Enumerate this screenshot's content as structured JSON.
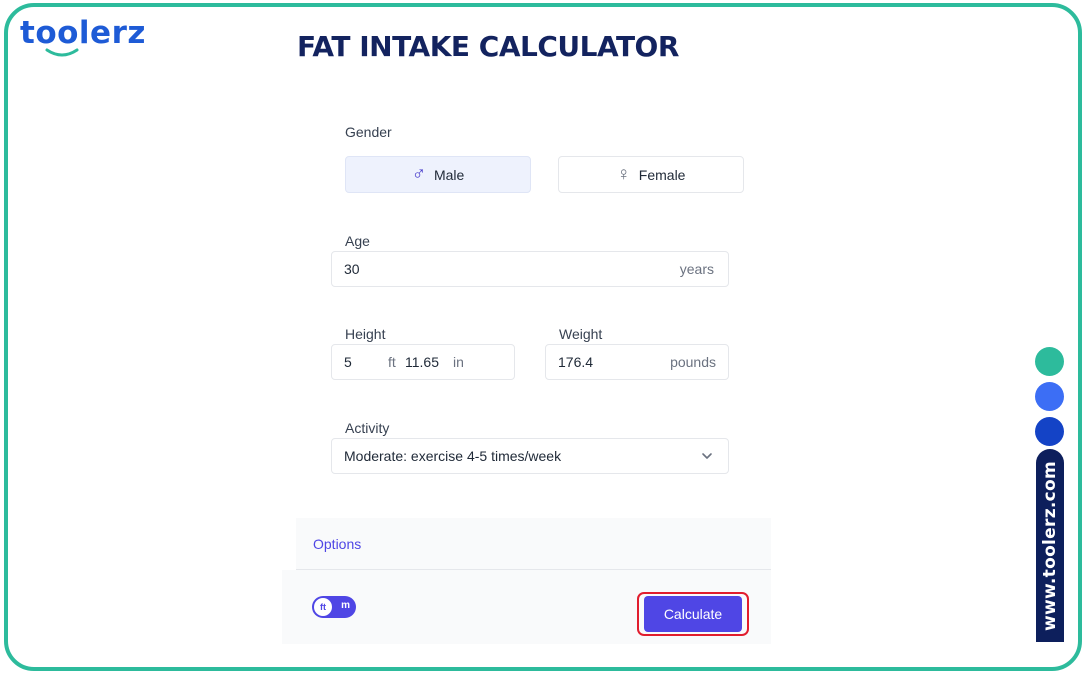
{
  "brand": {
    "logo_text": "toolerz",
    "watermark": "www.toolerz.com"
  },
  "page": {
    "title": "FAT INTAKE CALCULATOR"
  },
  "form": {
    "gender": {
      "label": "Gender",
      "options": [
        {
          "label": "Male",
          "symbol": "♂",
          "selected": true
        },
        {
          "label": "Female",
          "symbol": "♀",
          "selected": false
        }
      ]
    },
    "age": {
      "label": "Age",
      "value": "30",
      "unit": "years"
    },
    "height": {
      "label": "Height",
      "feet": "5",
      "feet_unit": "ft",
      "inches": "11.65",
      "inches_unit": "in"
    },
    "weight": {
      "label": "Weight",
      "value": "176.4",
      "unit": "pounds"
    },
    "activity": {
      "label": "Activity",
      "selected": "Moderate: exercise 4-5 times/week"
    }
  },
  "options": {
    "label": "Options"
  },
  "unit_toggle": {
    "left": "ft",
    "right": "m"
  },
  "actions": {
    "calculate": "Calculate"
  },
  "colors": {
    "frame": "#2dbb9c",
    "brand": "#1e5bd6",
    "accent": "#4f46e5",
    "highlight": "#e11d2e",
    "title": "#13235f",
    "dot_1": "#2dbb9c",
    "dot_2": "#3c6ef5",
    "dot_3": "#1443c6",
    "watermark_bg": "#0d1f5c"
  },
  "icons": {
    "male": "male-symbol-icon",
    "female": "female-symbol-icon",
    "dropdown": "chevron-down-icon"
  }
}
